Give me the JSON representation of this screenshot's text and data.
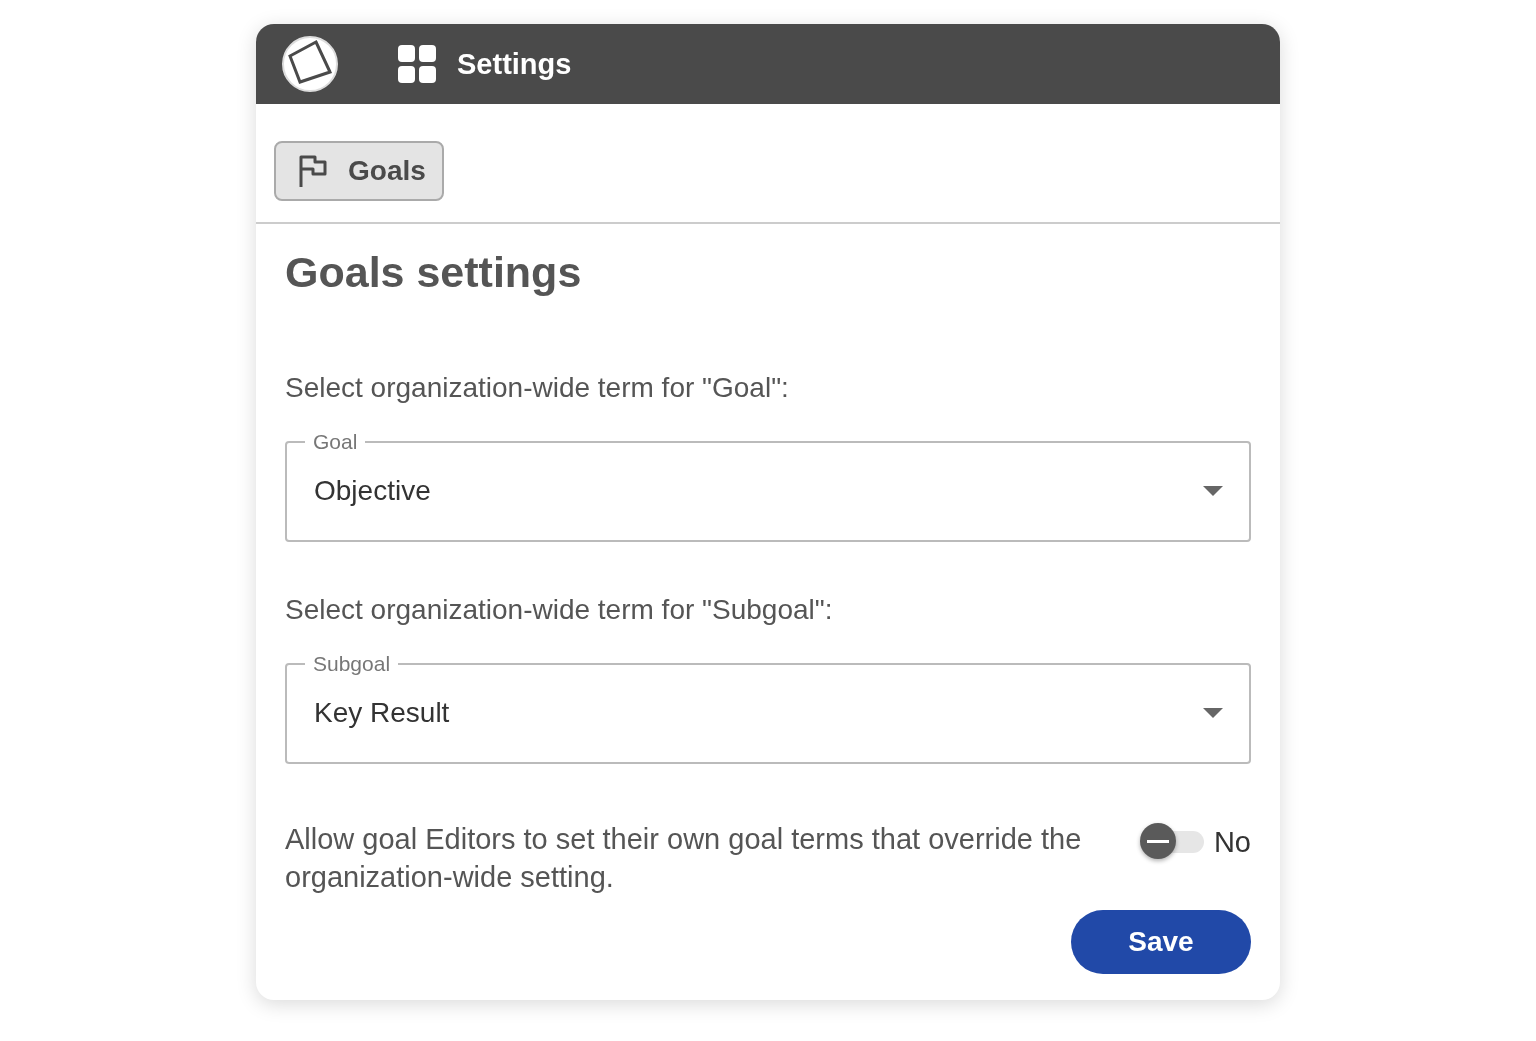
{
  "header": {
    "title": "Settings"
  },
  "tabs": [
    {
      "label": "Goals",
      "selected": true
    }
  ],
  "page_title": "Goals settings",
  "selects": [
    {
      "prompt": "Select organization-wide term for \"Goal\":",
      "label": "Goal",
      "value": "Objective"
    },
    {
      "prompt": "Select organization-wide term for \"Subgoal\":",
      "label": "Subgoal",
      "value": "Key Result"
    }
  ],
  "override": {
    "text": "Allow goal Editors to set their own goal terms that override the organization-wide setting.",
    "on": false,
    "state_label": "No"
  },
  "save_button": "Save"
}
